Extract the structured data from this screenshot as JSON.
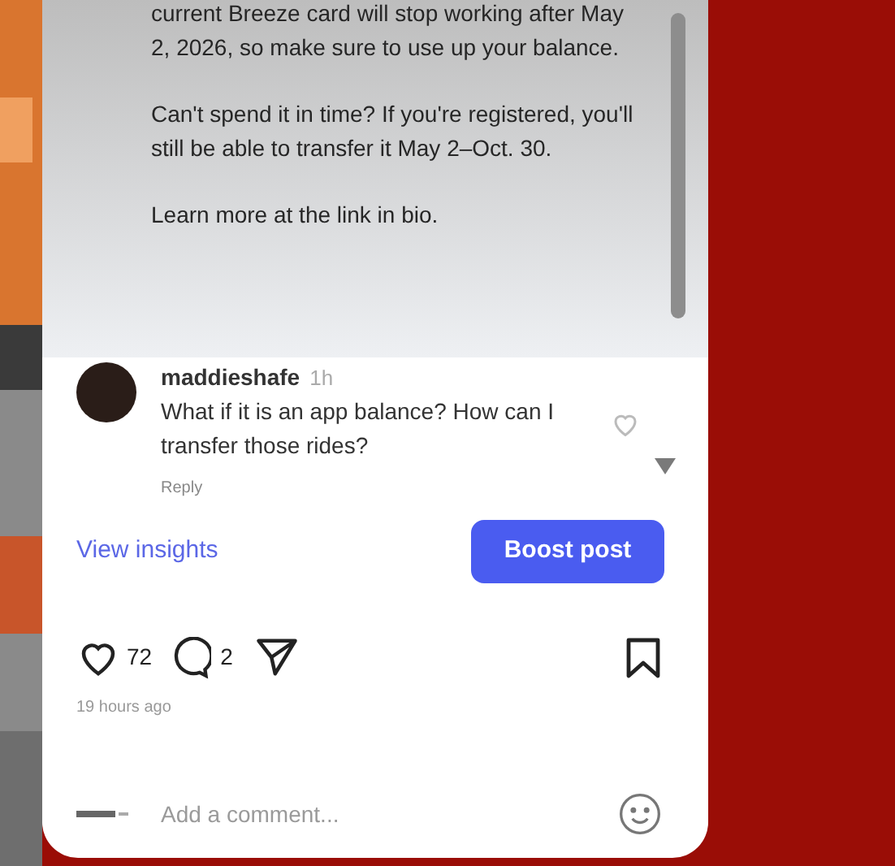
{
  "caption": [
    "current Breeze card will stop working after May 2, 2026, so make sure to use up your balance.",
    "Can't spend it in time? If you're registered, you'll still be able to transfer it May 2–Oct. 30.",
    "Learn more at the link in bio."
  ],
  "comment": {
    "username": "maddieshafe",
    "time": "1h",
    "text": "What if it is an app balance? How can I transfer those rides?",
    "reply": "Reply",
    "liked": false
  },
  "insights_link": "View insights",
  "boost_button": "Boost post",
  "actions": {
    "likes": "72",
    "comments": "2",
    "liked": false,
    "saved": false
  },
  "posted": "19 hours ago",
  "comment_field": {
    "placeholder": "Add a comment..."
  }
}
